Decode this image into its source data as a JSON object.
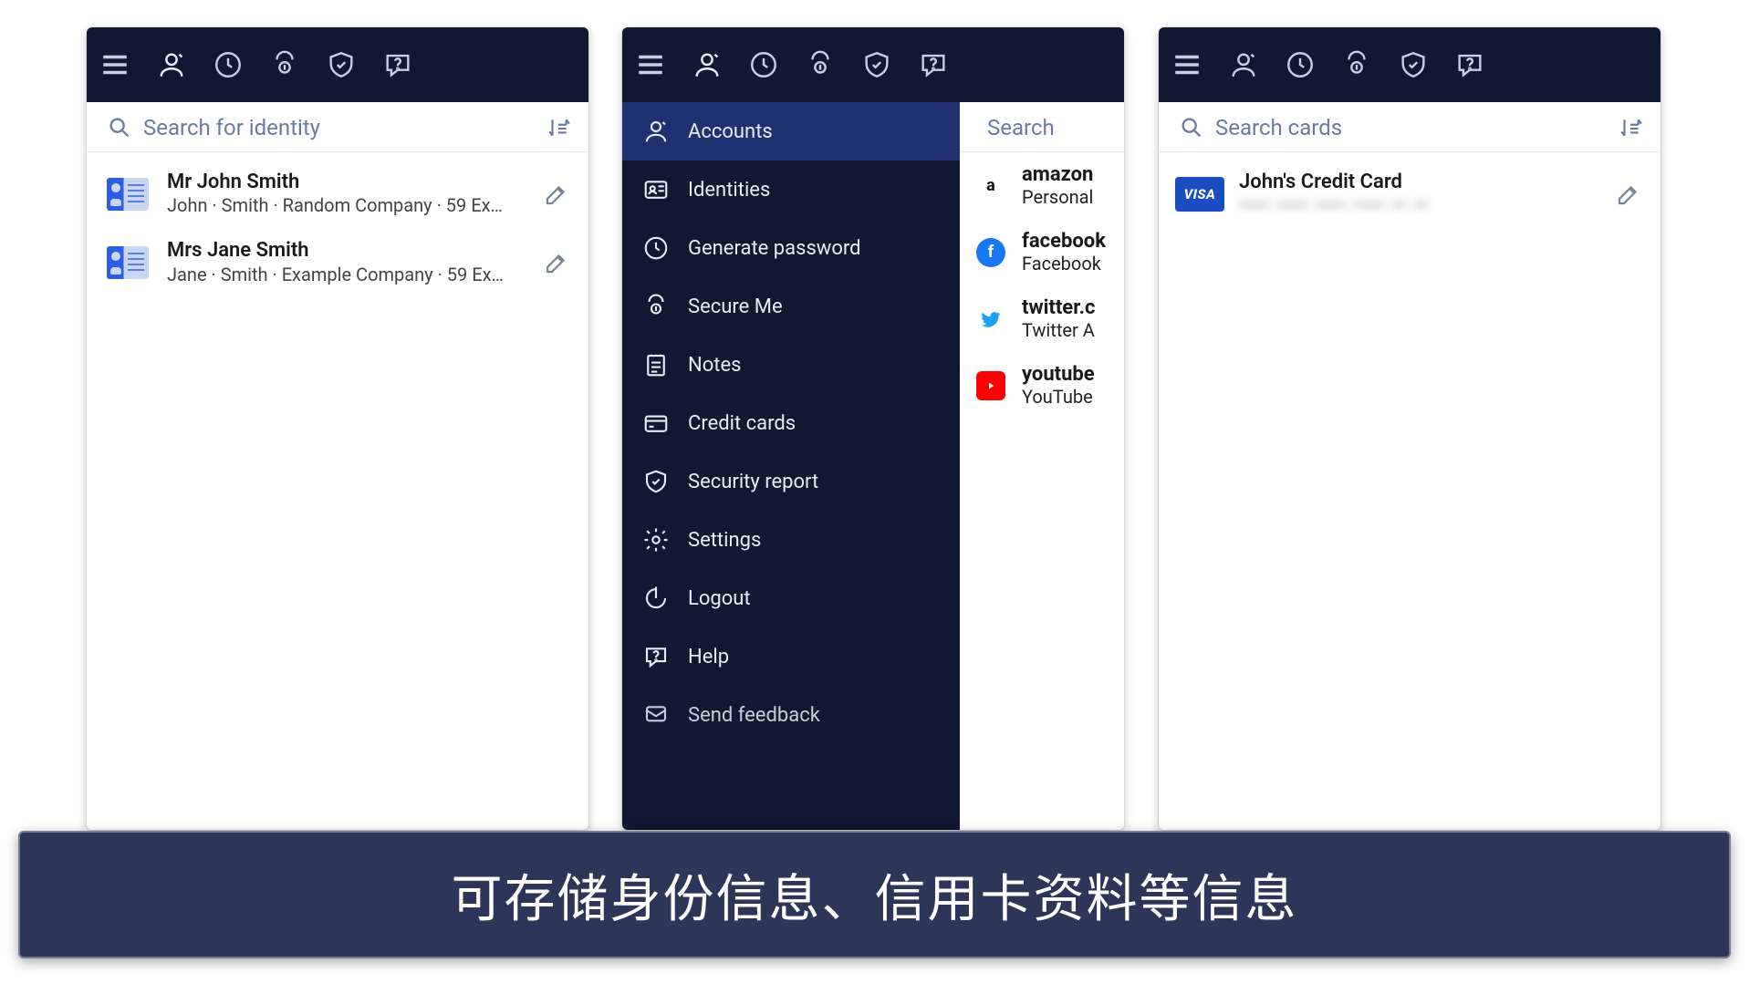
{
  "colors": {
    "bar": "#101832",
    "drawerActive": "#1f3170",
    "accent": "#2a5fe3"
  },
  "caption": "可存储身份信息、信用卡资料等信息",
  "topIcons": [
    "menu",
    "identity",
    "generate",
    "secure",
    "shield",
    "help"
  ],
  "panel1": {
    "search_placeholder": "Search for identity",
    "items": [
      {
        "title": "Mr John Smith",
        "sub": "John · Smith · Random Company · 59 Ex…"
      },
      {
        "title": "Mrs Jane Smith",
        "sub": "Jane · Smith · Example Company · 59 Ex…"
      }
    ]
  },
  "panel2": {
    "search_placeholder": "Search",
    "activeIndex": 0,
    "menu": [
      {
        "icon": "identity",
        "label": "Accounts"
      },
      {
        "icon": "idcard",
        "label": "Identities"
      },
      {
        "icon": "generate",
        "label": "Generate password"
      },
      {
        "icon": "secure",
        "label": "Secure Me"
      },
      {
        "icon": "notes",
        "label": "Notes"
      },
      {
        "icon": "card",
        "label": "Credit cards"
      },
      {
        "icon": "shield",
        "label": "Security report"
      },
      {
        "icon": "settings",
        "label": "Settings"
      },
      {
        "icon": "logout",
        "label": "Logout"
      },
      {
        "icon": "help",
        "label": "Help"
      },
      {
        "icon": "feedback",
        "label": "Send feedback"
      }
    ],
    "accounts": [
      {
        "brand": "amazon",
        "title": "amazon",
        "sub": "Personal"
      },
      {
        "brand": "fb",
        "title": "facebook",
        "sub": "Facebook"
      },
      {
        "brand": "tw",
        "title": "twitter.c",
        "sub": "Twitter A"
      },
      {
        "brand": "yt",
        "title": "youtube",
        "sub": "YouTube"
      }
    ]
  },
  "panel3": {
    "search_placeholder": "Search cards",
    "cards": [
      {
        "brand": "VISA",
        "title": "John's Credit Card",
        "masked": "•••• •••• •••• ••••  •• ••"
      }
    ]
  }
}
